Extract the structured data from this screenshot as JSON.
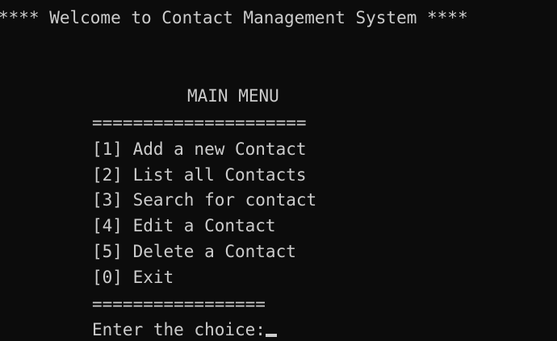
{
  "console": {
    "banner": "**** Welcome to Contact Management System ****",
    "menu_title": "MAIN MENU",
    "separator_top": "=====================",
    "items": [
      "[1] Add a new Contact",
      "[2] List all Contacts",
      "[3] Search for contact",
      "[4] Edit a Contact",
      "[5] Delete a Contact",
      "[0] Exit"
    ],
    "separator_bottom": "=================",
    "prompt": "Enter the choice:"
  },
  "colors": {
    "background": "#0c0c0c",
    "foreground": "#cccccc"
  }
}
